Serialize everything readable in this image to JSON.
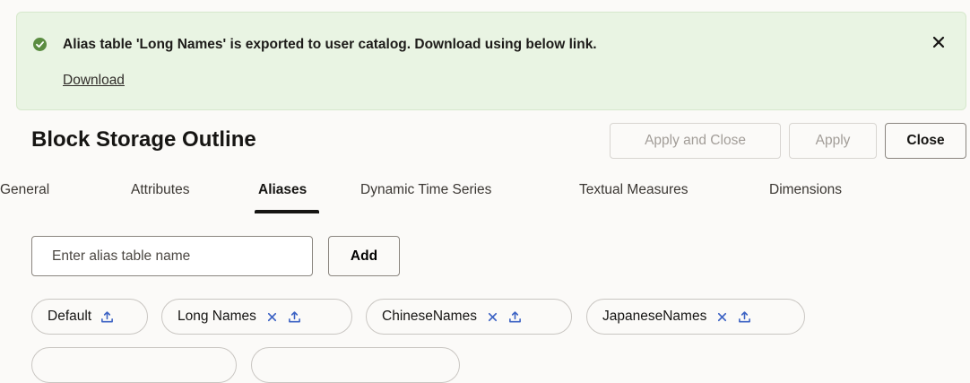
{
  "banner": {
    "message": "Alias table 'Long Names' is exported to user catalog. Download using below link.",
    "link": "Download",
    "status_color": "#5b8c41"
  },
  "header": {
    "title": "Block Storage Outline",
    "apply_and_close_label": "Apply and Close",
    "apply_label": "Apply",
    "close_label": "Close"
  },
  "tabs": [
    {
      "label": "General"
    },
    {
      "label": "Attributes"
    },
    {
      "label": "Aliases"
    },
    {
      "label": "Dynamic Time Series"
    },
    {
      "label": "Textual Measures"
    },
    {
      "label": "Dimensions"
    }
  ],
  "alias_form": {
    "placeholder": "Enter alias table name",
    "add_label": "Add"
  },
  "alias_tables": [
    {
      "name": "Default",
      "removable": false
    },
    {
      "name": "Long Names",
      "removable": true
    },
    {
      "name": "ChineseNames",
      "removable": true
    },
    {
      "name": "JapaneseNames",
      "removable": true
    }
  ],
  "icons": {
    "success": "check-circle-icon",
    "dismiss": "close-icon",
    "remove": "close-icon",
    "export": "upload-icon"
  }
}
